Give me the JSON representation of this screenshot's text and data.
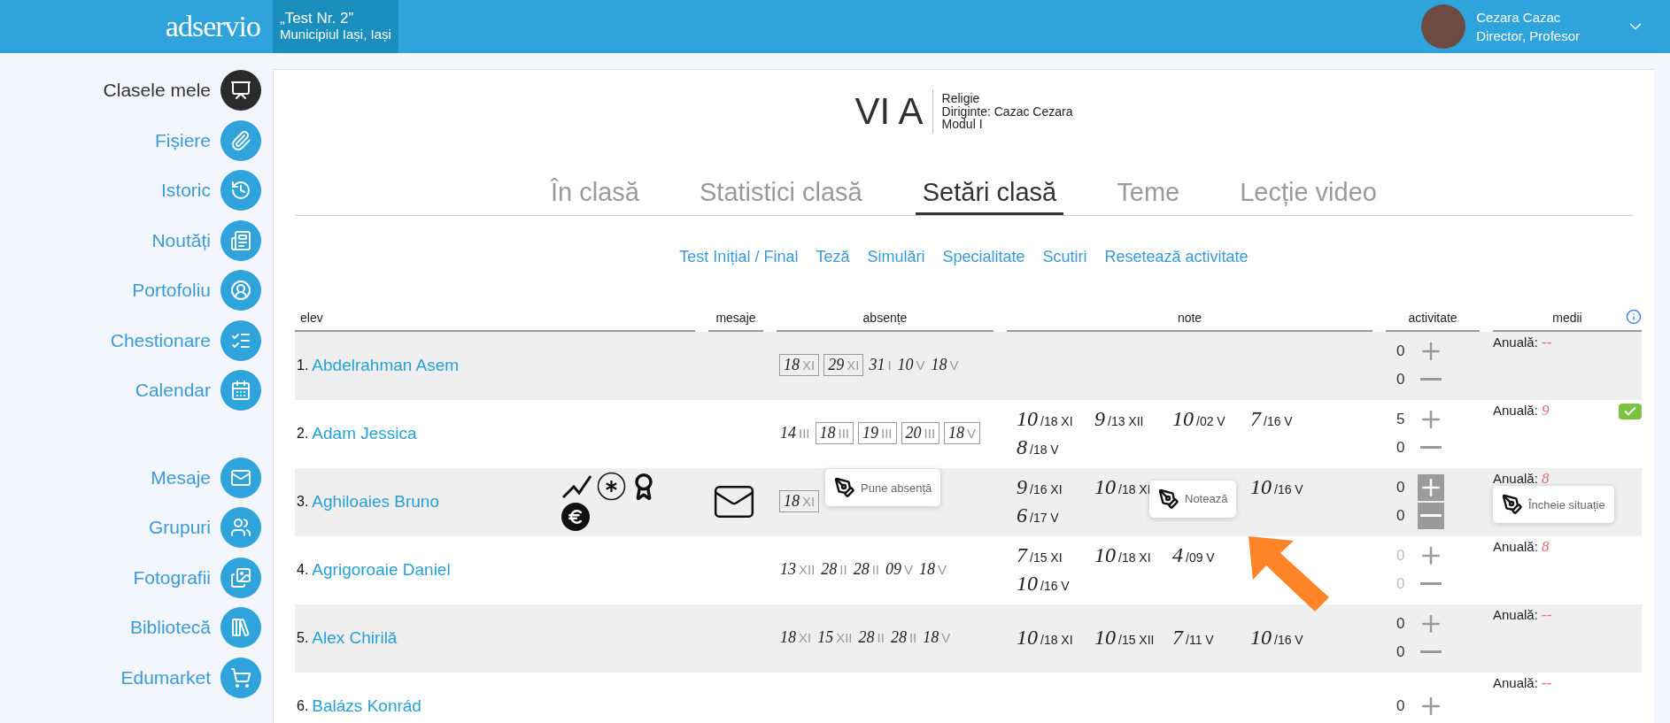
{
  "header": {
    "logo": "adservio",
    "school": {
      "name": "„Test Nr. 2”",
      "location": "Municipiul Iași, Iași"
    },
    "user": {
      "name": "Cezara Cazac",
      "role": "Director, Profesor"
    }
  },
  "sidebar": {
    "sections": [
      {
        "items": [
          {
            "label": "Clasele mele",
            "kind": "classes",
            "selected": true
          },
          {
            "label": "Fișiere",
            "kind": "files",
            "selected": false
          },
          {
            "label": "Istoric",
            "kind": "history",
            "selected": false
          },
          {
            "label": "Noutăți",
            "kind": "news",
            "selected": false
          },
          {
            "label": "Portofoliu",
            "kind": "portfolio",
            "selected": false
          },
          {
            "label": "Chestionare",
            "kind": "quiz",
            "selected": false
          },
          {
            "label": "Calendar",
            "kind": "calendar",
            "selected": false
          }
        ]
      },
      {
        "items": [
          {
            "label": "Mesaje",
            "kind": "messages",
            "selected": false
          },
          {
            "label": "Grupuri",
            "kind": "groups",
            "selected": false
          },
          {
            "label": "Fotografii",
            "kind": "photos",
            "selected": false
          },
          {
            "label": "Bibliotecă",
            "kind": "library",
            "selected": false
          },
          {
            "label": "Edumarket",
            "kind": "market",
            "selected": false
          }
        ]
      }
    ]
  },
  "class_info": {
    "name": "VI A",
    "subject": "Religie",
    "head_teacher": "Diriginte: Cazac Cezara",
    "module": "Modul I"
  },
  "tabs": [
    {
      "label": "În clasă",
      "selected": false
    },
    {
      "label": "Statistici clasă",
      "selected": false
    },
    {
      "label": "Setări clasă",
      "selected": true
    },
    {
      "label": "Teme",
      "selected": false
    },
    {
      "label": "Lecție video",
      "selected": false
    }
  ],
  "sub_links": [
    "Test Inițial / Final",
    "Teză",
    "Simulări",
    "Specialitate",
    "Scutiri",
    "Resetează activitate"
  ],
  "table": {
    "columns": [
      "elev",
      "mesaje",
      "absențe",
      "note",
      "activitate",
      "medii"
    ],
    "rows": [
      {
        "index": "1.",
        "name": "Abdelrahman Asem",
        "badges": [],
        "has_message": false,
        "absences": [
          {
            "kind": "absence",
            "day": "18",
            "month": "XI",
            "boxed": true
          },
          {
            "kind": "absence",
            "day": "29",
            "month": "XI",
            "boxed": true
          },
          {
            "kind": "absence",
            "day": "31",
            "month": "I",
            "boxed": false
          },
          {
            "kind": "absence",
            "day": "10",
            "month": "V",
            "boxed": false
          },
          {
            "kind": "absence",
            "day": "18",
            "month": "V",
            "boxed": false
          }
        ],
        "grades": [],
        "activity": {
          "plus": "0",
          "minus": "0",
          "highlighted": false,
          "dimmed": false
        },
        "average": {
          "label": "Anuală:",
          "value": "--",
          "closed": false
        }
      },
      {
        "index": "2.",
        "name": "Adam Jessica",
        "badges": [],
        "has_message": false,
        "absences": [
          {
            "kind": "absence",
            "day": "14",
            "month": "III",
            "boxed": false
          },
          {
            "kind": "absence",
            "day": "18",
            "month": "III",
            "boxed": true
          },
          {
            "kind": "absence",
            "day": "19",
            "month": "III",
            "boxed": true
          },
          {
            "kind": "absence",
            "day": "20",
            "month": "III",
            "boxed": true
          },
          {
            "kind": "absence",
            "day": "18",
            "month": "V",
            "boxed": true
          }
        ],
        "grades": [
          {
            "kind": "grade",
            "grade": "10",
            "date": "/18 XI"
          },
          {
            "kind": "grade",
            "grade": "9",
            "date": "/13 XII"
          },
          {
            "kind": "grade",
            "grade": "10",
            "date": "/02 V"
          },
          {
            "kind": "grade",
            "grade": "7",
            "date": "/16 V"
          },
          {
            "kind": "grade",
            "grade": "8",
            "date": "/18 V"
          }
        ],
        "activity": {
          "plus": "5",
          "minus": "0",
          "highlighted": false,
          "dimmed": false
        },
        "average": {
          "label": "Anuală:",
          "value": "9",
          "closed": true
        }
      },
      {
        "index": "3.",
        "name": "Aghiloaies Bruno",
        "badges": [
          {
            "kind": "trend"
          },
          {
            "kind": "star"
          },
          {
            "kind": "award"
          },
          {
            "kind": "euro"
          }
        ],
        "has_message": true,
        "absences": [
          {
            "kind": "absence",
            "day": "18",
            "month": "XI",
            "boxed": true
          },
          {
            "kind": "popup",
            "label": "Pune absență"
          }
        ],
        "grades": [
          {
            "kind": "grade",
            "grade": "9",
            "date": "/16 XI"
          },
          {
            "kind": "grade",
            "grade": "10",
            "date": "/18 XI"
          },
          {
            "kind": "popup",
            "label": "Notează"
          },
          {
            "kind": "grade",
            "grade": "10",
            "date": "/16 V"
          },
          {
            "kind": "grade",
            "grade": "6",
            "date": "/17 V"
          }
        ],
        "activity": {
          "plus": "0",
          "minus": "0",
          "highlighted": true,
          "dimmed": false
        },
        "average": {
          "label": "Anuală:",
          "value": "8",
          "closed": false,
          "popup": "Încheie situație"
        }
      },
      {
        "index": "4.",
        "name": "Agrigoroaie Daniel",
        "badges": [],
        "has_message": false,
        "absences": [
          {
            "kind": "absence",
            "day": "13",
            "month": "XII",
            "boxed": false
          },
          {
            "kind": "absence",
            "day": "28",
            "month": "II",
            "boxed": false
          },
          {
            "kind": "absence",
            "day": "28",
            "month": "II",
            "boxed": false
          },
          {
            "kind": "absence",
            "day": "09",
            "month": "V",
            "boxed": false
          },
          {
            "kind": "absence",
            "day": "18",
            "month": "V",
            "boxed": false
          }
        ],
        "grades": [
          {
            "kind": "grade",
            "grade": "7",
            "date": "/15 XI"
          },
          {
            "kind": "grade",
            "grade": "10",
            "date": "/18 XI"
          },
          {
            "kind": "grade",
            "grade": "4",
            "date": "/09 V"
          },
          {
            "kind": "blank"
          },
          {
            "kind": "grade",
            "grade": "10",
            "date": "/16 V"
          }
        ],
        "activity": {
          "plus": "0",
          "minus": "0",
          "highlighted": false,
          "dimmed": true
        },
        "average": {
          "label": "Anuală:",
          "value": "8",
          "closed": false
        }
      },
      {
        "index": "5.",
        "name": "Alex Chirilă",
        "badges": [],
        "has_message": false,
        "absences": [
          {
            "kind": "absence",
            "day": "18",
            "month": "XI",
            "boxed": false
          },
          {
            "kind": "absence",
            "day": "15",
            "month": "XII",
            "boxed": false
          },
          {
            "kind": "absence",
            "day": "28",
            "month": "II",
            "boxed": false
          },
          {
            "kind": "absence",
            "day": "28",
            "month": "II",
            "boxed": false
          },
          {
            "kind": "absence",
            "day": "18",
            "month": "V",
            "boxed": false
          }
        ],
        "grades": [
          {
            "kind": "grade",
            "grade": "10",
            "date": "/18 XI"
          },
          {
            "kind": "grade",
            "grade": "10",
            "date": "/15 XII"
          },
          {
            "kind": "grade",
            "grade": "7",
            "date": "/11 V"
          },
          {
            "kind": "grade",
            "grade": "10",
            "date": "/16 V"
          }
        ],
        "activity": {
          "plus": "0",
          "minus": "0",
          "highlighted": false,
          "dimmed": false
        },
        "average": {
          "label": "Anuală:",
          "value": "--",
          "closed": false
        }
      },
      {
        "index": "6.",
        "name": "Balázs Konrád",
        "badges": [],
        "has_message": false,
        "absences": [],
        "grades": [],
        "activity": {
          "plus": "0",
          "highlighted": false,
          "dimmed": false
        },
        "average": {
          "label": "Anuală:",
          "value": "--",
          "closed": false
        }
      }
    ]
  }
}
